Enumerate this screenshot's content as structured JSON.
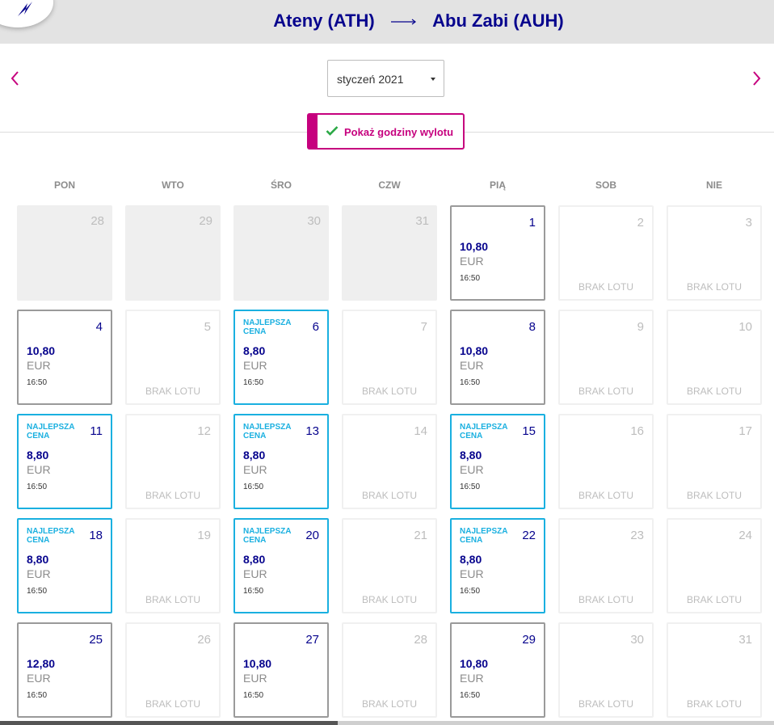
{
  "header": {
    "origin": "Ateny (ATH)",
    "destination": "Abu Zabi (AUH)",
    "logo_icon": "wizz-logo-icon",
    "arrow_icon": "long-arrow-right-icon"
  },
  "colors": {
    "brand_navy": "#06038d",
    "brand_magenta": "#c6007e",
    "best_price_blue": "#1ab0e0"
  },
  "nav": {
    "prev_icon": "chevron-left-icon",
    "next_icon": "chevron-right-icon"
  },
  "month_select": {
    "value": "styczeń 2021"
  },
  "times_toggle": {
    "label": "Pokaż godziny wylotu",
    "checked": true
  },
  "weekdays": [
    "PON",
    "WTO",
    "ŚRO",
    "CZW",
    "PIĄ",
    "SOB",
    "NIE"
  ],
  "calendar": {
    "best_label": "NAJLEPSZA CENA",
    "no_flight_label": "BRAK LOTU",
    "days": [
      {
        "day": "28",
        "state": "outside"
      },
      {
        "day": "29",
        "state": "outside"
      },
      {
        "day": "30",
        "state": "outside"
      },
      {
        "day": "31",
        "state": "outside"
      },
      {
        "day": "1",
        "state": "flight",
        "price": "10,80",
        "currency": "EUR",
        "time": "16:50"
      },
      {
        "day": "2",
        "state": "noflight"
      },
      {
        "day": "3",
        "state": "noflight"
      },
      {
        "day": "4",
        "state": "flight",
        "price": "10,80",
        "currency": "EUR",
        "time": "16:50"
      },
      {
        "day": "5",
        "state": "noflight"
      },
      {
        "day": "6",
        "state": "best",
        "price": "8,80",
        "currency": "EUR",
        "time": "16:50"
      },
      {
        "day": "7",
        "state": "noflight"
      },
      {
        "day": "8",
        "state": "flight",
        "price": "10,80",
        "currency": "EUR",
        "time": "16:50"
      },
      {
        "day": "9",
        "state": "noflight"
      },
      {
        "day": "10",
        "state": "noflight"
      },
      {
        "day": "11",
        "state": "best",
        "price": "8,80",
        "currency": "EUR",
        "time": "16:50"
      },
      {
        "day": "12",
        "state": "noflight"
      },
      {
        "day": "13",
        "state": "best",
        "price": "8,80",
        "currency": "EUR",
        "time": "16:50"
      },
      {
        "day": "14",
        "state": "noflight"
      },
      {
        "day": "15",
        "state": "best",
        "price": "8,80",
        "currency": "EUR",
        "time": "16:50"
      },
      {
        "day": "16",
        "state": "noflight"
      },
      {
        "day": "17",
        "state": "noflight"
      },
      {
        "day": "18",
        "state": "best",
        "price": "8,80",
        "currency": "EUR",
        "time": "16:50"
      },
      {
        "day": "19",
        "state": "noflight"
      },
      {
        "day": "20",
        "state": "best",
        "price": "8,80",
        "currency": "EUR",
        "time": "16:50"
      },
      {
        "day": "21",
        "state": "noflight"
      },
      {
        "day": "22",
        "state": "best",
        "price": "8,80",
        "currency": "EUR",
        "time": "16:50"
      },
      {
        "day": "23",
        "state": "noflight"
      },
      {
        "day": "24",
        "state": "noflight"
      },
      {
        "day": "25",
        "state": "flight",
        "price": "12,80",
        "currency": "EUR",
        "time": "16:50"
      },
      {
        "day": "26",
        "state": "noflight"
      },
      {
        "day": "27",
        "state": "flight",
        "price": "10,80",
        "currency": "EUR",
        "time": "16:50"
      },
      {
        "day": "28",
        "state": "noflight"
      },
      {
        "day": "29",
        "state": "flight",
        "price": "10,80",
        "currency": "EUR",
        "time": "16:50"
      },
      {
        "day": "30",
        "state": "noflight"
      },
      {
        "day": "31",
        "state": "noflight"
      }
    ]
  }
}
